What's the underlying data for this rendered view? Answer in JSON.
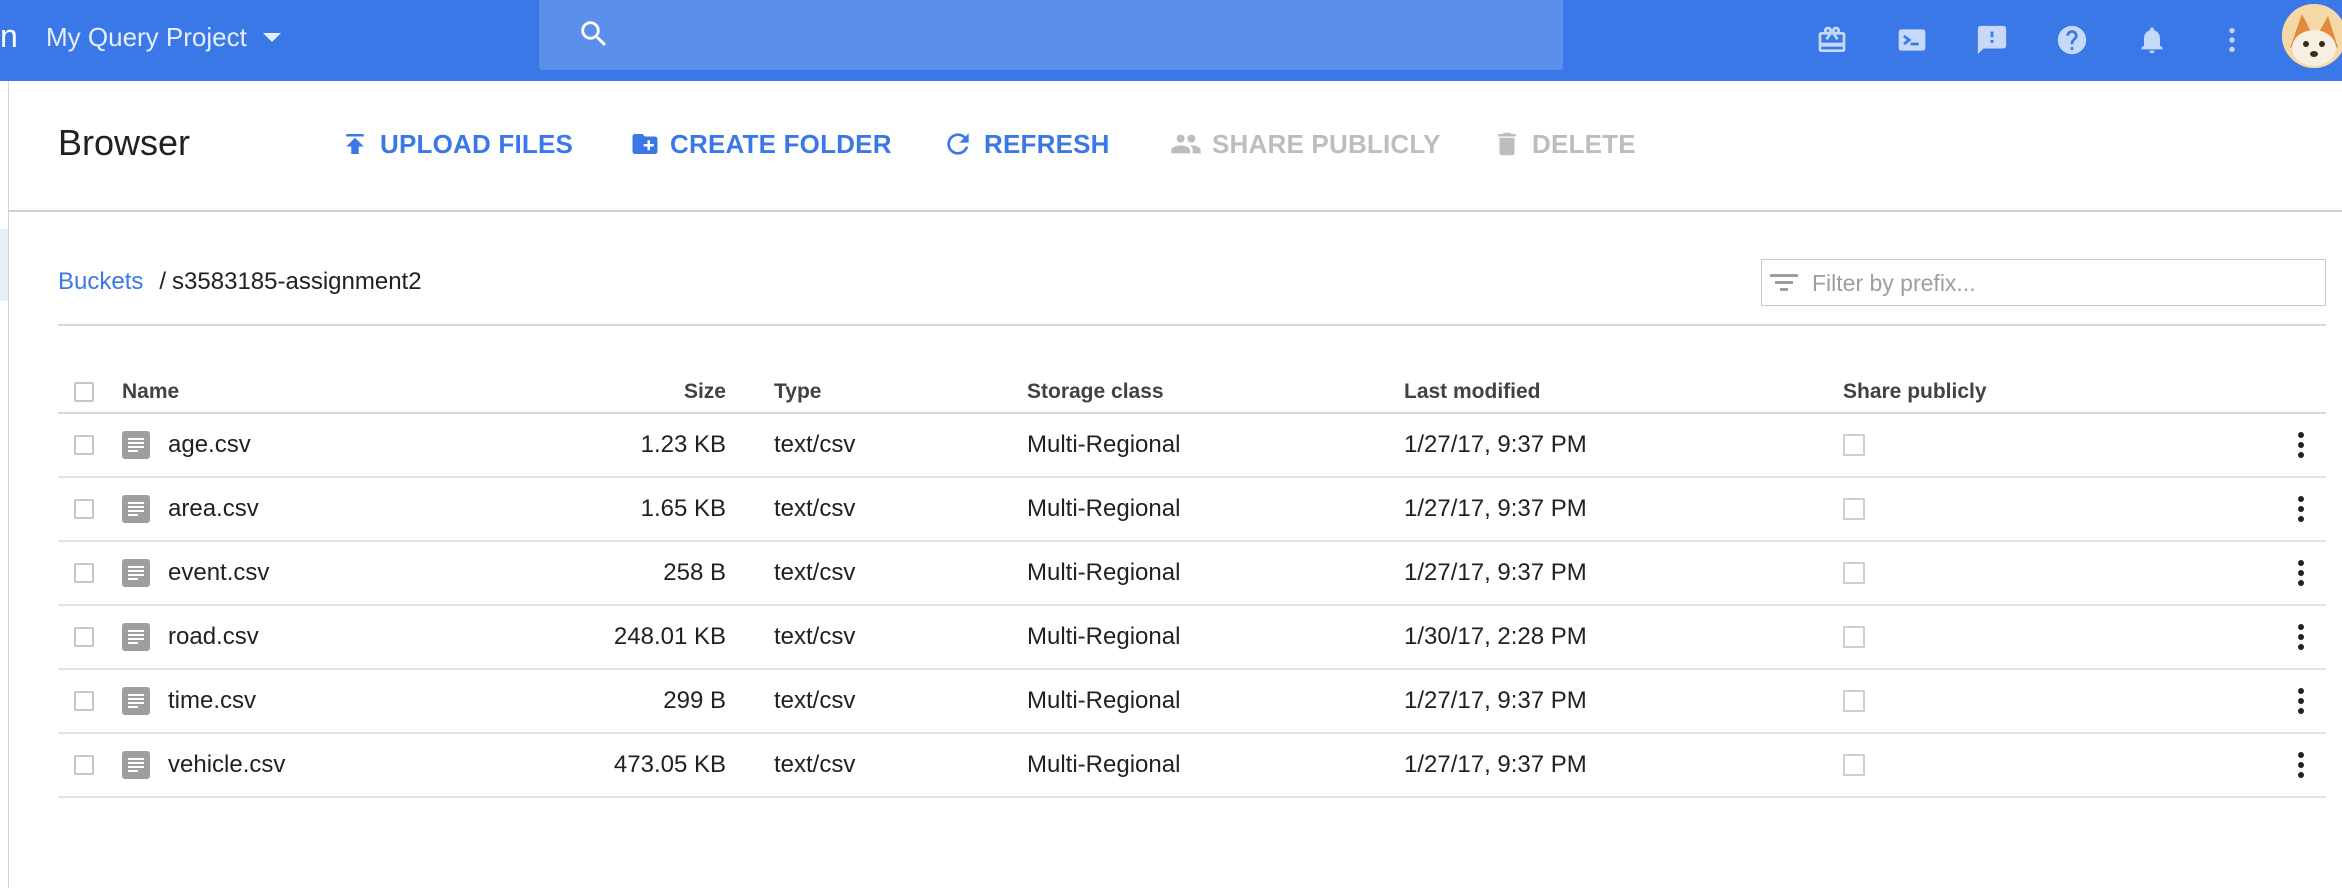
{
  "app": {
    "brand_fragment": "n",
    "project_name": "My Query Project"
  },
  "search": {
    "placeholder": ""
  },
  "header_icons": [
    "gift-icon",
    "cloud-shell-icon",
    "feedback-icon",
    "help-icon",
    "notifications-icon",
    "more-vert-icon"
  ],
  "toolbar": {
    "title": "Browser",
    "upload_label": "UPLOAD FILES",
    "create_folder_label": "CREATE FOLDER",
    "refresh_label": "REFRESH",
    "share_publicly_label": "SHARE PUBLICLY",
    "delete_label": "DELETE"
  },
  "breadcrumb": {
    "root": "Buckets",
    "separator": "/",
    "current": "s3583185-assignment2"
  },
  "filter": {
    "placeholder": "Filter by prefix..."
  },
  "table": {
    "headers": {
      "name": "Name",
      "size": "Size",
      "type": "Type",
      "storage_class": "Storage class",
      "last_modified": "Last modified",
      "share_publicly": "Share publicly"
    },
    "rows": [
      {
        "name": "age.csv",
        "size": "1.23 KB",
        "type": "text/csv",
        "storage_class": "Multi-Regional",
        "last_modified": "1/27/17, 9:37 PM"
      },
      {
        "name": "area.csv",
        "size": "1.65 KB",
        "type": "text/csv",
        "storage_class": "Multi-Regional",
        "last_modified": "1/27/17, 9:37 PM"
      },
      {
        "name": "event.csv",
        "size": "258 B",
        "type": "text/csv",
        "storage_class": "Multi-Regional",
        "last_modified": "1/27/17, 9:37 PM"
      },
      {
        "name": "road.csv",
        "size": "248.01 KB",
        "type": "text/csv",
        "storage_class": "Multi-Regional",
        "last_modified": "1/30/17, 2:28 PM"
      },
      {
        "name": "time.csv",
        "size": "299 B",
        "type": "text/csv",
        "storage_class": "Multi-Regional",
        "last_modified": "1/27/17, 9:37 PM"
      },
      {
        "name": "vehicle.csv",
        "size": "473.05 KB",
        "type": "text/csv",
        "storage_class": "Multi-Regional",
        "last_modified": "1/27/17, 9:37 PM"
      }
    ]
  },
  "colors": {
    "topbar": "#3b78e7",
    "accent": "#3b78e7",
    "disabled": "#bdbdbd"
  }
}
